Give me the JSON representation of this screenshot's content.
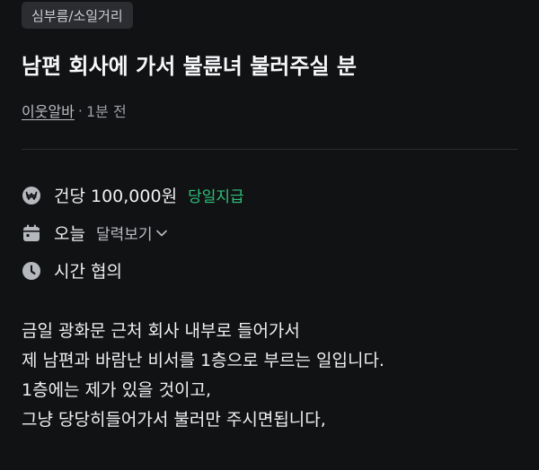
{
  "category": "심부름/소일거리",
  "title": "남편 회사에 가서 불륜녀 불러주실 분",
  "meta": {
    "author": "이웃알바",
    "separator": "·",
    "time_ago": "1분 전"
  },
  "info": {
    "pay": {
      "icon": "won-coin-icon",
      "text": "건당 100,000원",
      "badge": "당일지급",
      "badge_color": "#2fc27a"
    },
    "date": {
      "icon": "calendar-icon",
      "text": "오늘",
      "link": "달력보기"
    },
    "time": {
      "icon": "clock-icon",
      "text": "시간 협의"
    }
  },
  "body_lines": [
    "금일 광화문 근처 회사 내부로 들어가서",
    "제 남편과 바람난 비서를 1층으로 부르는 일입니다.",
    "1층에는 제가 있을 것이고,",
    "그냥 당당히들어가서 불러만 주시면됩니다,"
  ],
  "colors": {
    "background": "#111214",
    "accent_green": "#2fc27a",
    "tag_bg": "#2b2d31"
  }
}
